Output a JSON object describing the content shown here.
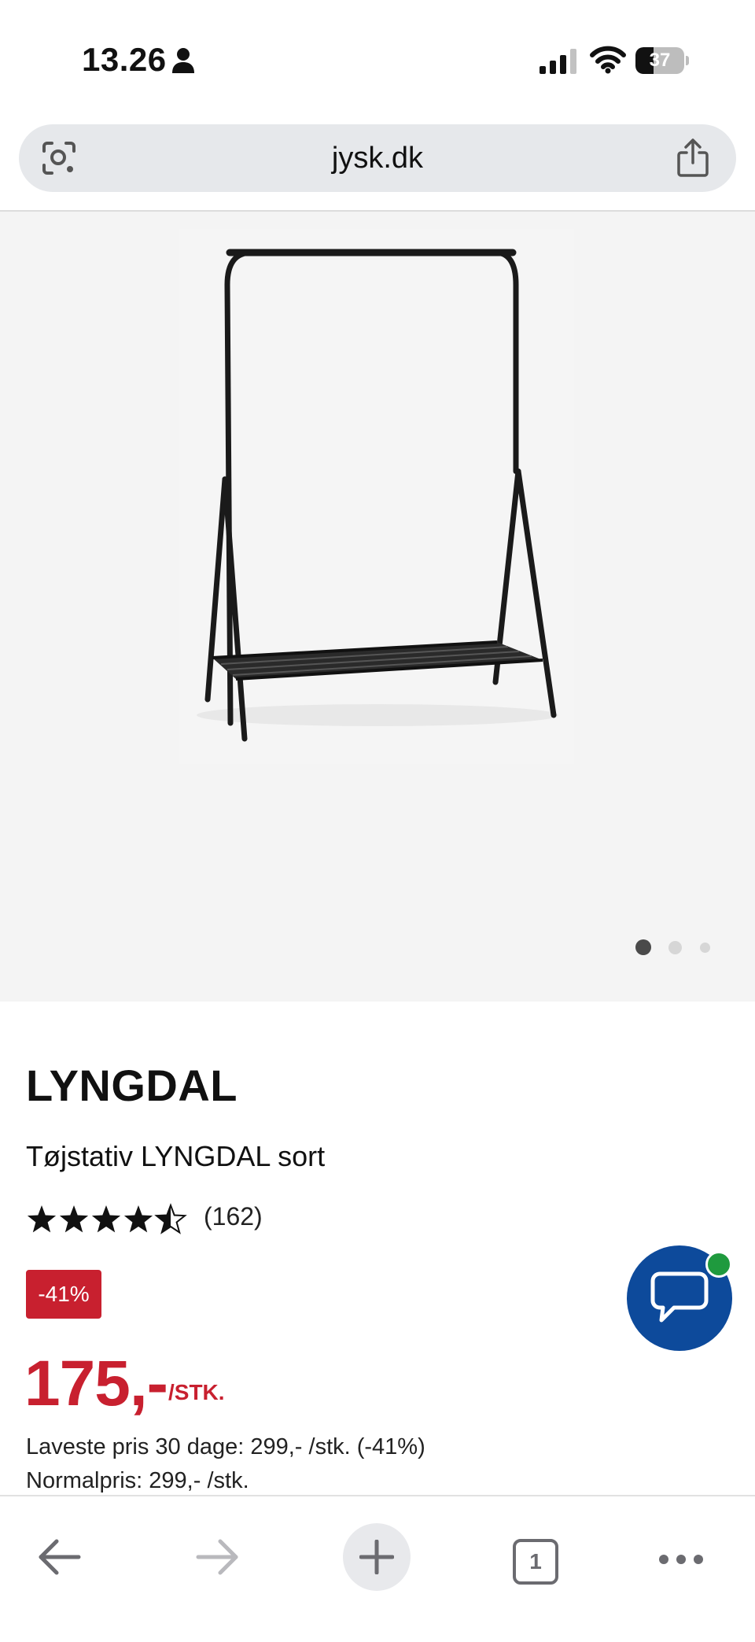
{
  "status_bar": {
    "time": "13.26",
    "battery_level": "37",
    "battery_fraction": 0.37,
    "icons": [
      "person-icon",
      "signal-icon",
      "wifi-icon",
      "battery-icon"
    ]
  },
  "browser": {
    "url": "jysk.dk",
    "icons": [
      "lens-icon",
      "share-icon"
    ]
  },
  "gallery": {
    "image": "clothes-rack-image",
    "page_count": 3,
    "active_index": 0
  },
  "product": {
    "brand": "LYNGDAL",
    "name": "Tøjstativ LYNGDAL sort",
    "rating": 4.5,
    "rating_max": 5,
    "review_count": "(162)",
    "discount_badge": "-41%",
    "price": "175,-",
    "price_unit": "/STK.",
    "lowest_price": "Laveste pris 30 dage: 299,- /stk. (-41%)",
    "normal_price": "Normalpris: 299,- /stk."
  },
  "chat": {
    "icon": "chat-bubble-icon",
    "status_color": "#1f9a3e"
  },
  "toolbar": {
    "tab_count": "1",
    "icons": [
      "back-arrow-icon",
      "forward-arrow-icon",
      "plus-icon",
      "tabs-icon",
      "more-icon"
    ]
  },
  "colors": {
    "accent_red": "#c8202f",
    "chat_blue": "#0d4a9b",
    "url_bar_bg": "#e6e8eb",
    "image_bg": "#f4f4f4"
  }
}
